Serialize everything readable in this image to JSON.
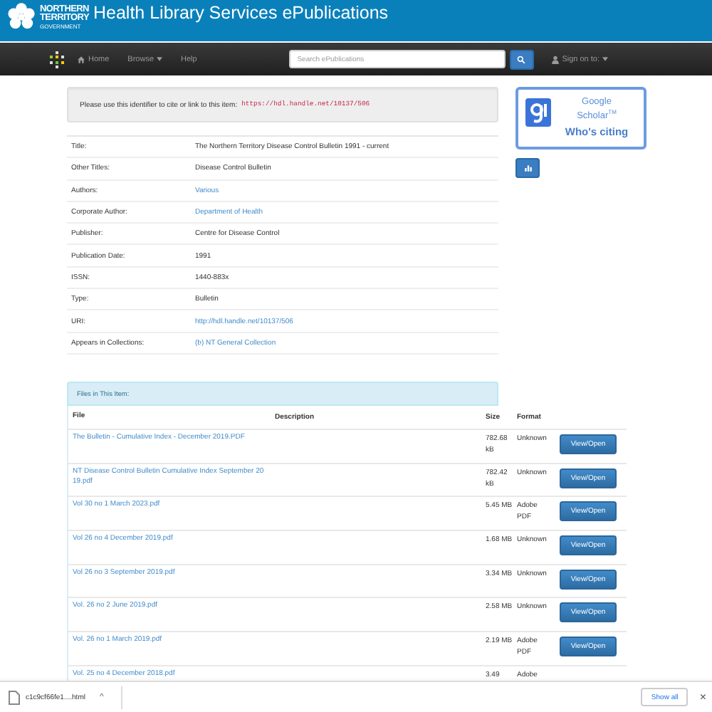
{
  "header": {
    "logo_lines": [
      "NORTHERN",
      "TERRITORY",
      "GOVERNMENT"
    ],
    "title": "Health Library Services ePublications"
  },
  "nav": {
    "items": [
      {
        "label": "Home",
        "kind": "home"
      },
      {
        "label": "Browse",
        "kind": "dropdown"
      },
      {
        "label": "Help",
        "kind": "plain"
      }
    ],
    "search": {
      "placeholder": "Search ePublications"
    },
    "sign_on": "Sign on to:"
  },
  "identifier": {
    "text": "Please use this identifier to cite or link to this item:",
    "url": "https://hdl.handle.net/10137/506"
  },
  "metadata": [
    {
      "label": "Title:",
      "value": "The Northern Territory Disease Control Bulletin 1991 - current",
      "kind": "text"
    },
    {
      "label": "Other Titles:",
      "value": "Disease Control Bulletin",
      "kind": "text"
    },
    {
      "label": "Authors:",
      "value": "Various",
      "kind": "link"
    },
    {
      "label": "Corporate Author:",
      "value": "Department of Health",
      "kind": "link"
    },
    {
      "label": "Publisher:",
      "value": "Centre for Disease Control",
      "kind": "text"
    },
    {
      "label": "Publication Date:",
      "value": "1991",
      "kind": "text"
    },
    {
      "label": "ISSN:",
      "value": "1440-883x",
      "kind": "text"
    },
    {
      "label": "Type:",
      "value": "Bulletin",
      "kind": "text"
    },
    {
      "label": "URI:",
      "value": "http://hdl.handle.net/10137/506",
      "kind": "link"
    },
    {
      "label": "Appears in Collections:",
      "value": "(b) NT General Collection",
      "kind": "link"
    }
  ],
  "scholar": {
    "name": "Google",
    "sub": "Scholar",
    "tm": "TM",
    "cta": "Who's citing"
  },
  "files": {
    "title": "Files in This Item:",
    "columns": [
      "File",
      "Description",
      "Size",
      "Format"
    ],
    "rows": [
      {
        "file": "The Bulletin - Cumulative Index - December 2019.PDF",
        "size": "782.68 kB",
        "format": "Unknown",
        "button": "View/Open"
      },
      {
        "file": "NT Disease Control Bulletin Cumulative Index September 2019.pdf",
        "size": "782.42 kB",
        "format": "Unknown",
        "button": "View/Open"
      },
      {
        "file": "Vol 30 no 1 March 2023.pdf",
        "size": "5.45 MB",
        "format": "Adobe PDF",
        "button": "View/Open"
      },
      {
        "file": "Vol 26 no 4 December 2019.pdf",
        "size": "1.68 MB",
        "format": "Unknown",
        "button": "View/Open"
      },
      {
        "file": "Vol 26 no 3 September 2019.pdf",
        "size": "3.34 MB",
        "format": "Unknown",
        "button": "View/Open"
      },
      {
        "file": "Vol. 26 no 2 June 2019.pdf",
        "size": "2.58 MB",
        "format": "Unknown",
        "button": "View/Open"
      },
      {
        "file": "Vol. 26 no 1 March 2019.pdf",
        "size": "2.19 MB",
        "format": "Adobe PDF",
        "button": "View/Open"
      },
      {
        "file": "Vol. 25 no 4 December 2018.pdf",
        "size": "3.49",
        "format": "Adobe"
      }
    ]
  },
  "download_bar": {
    "file": "c1c9cf66fe1....html",
    "caret": "^",
    "show_all": "Show all",
    "close": "×"
  }
}
